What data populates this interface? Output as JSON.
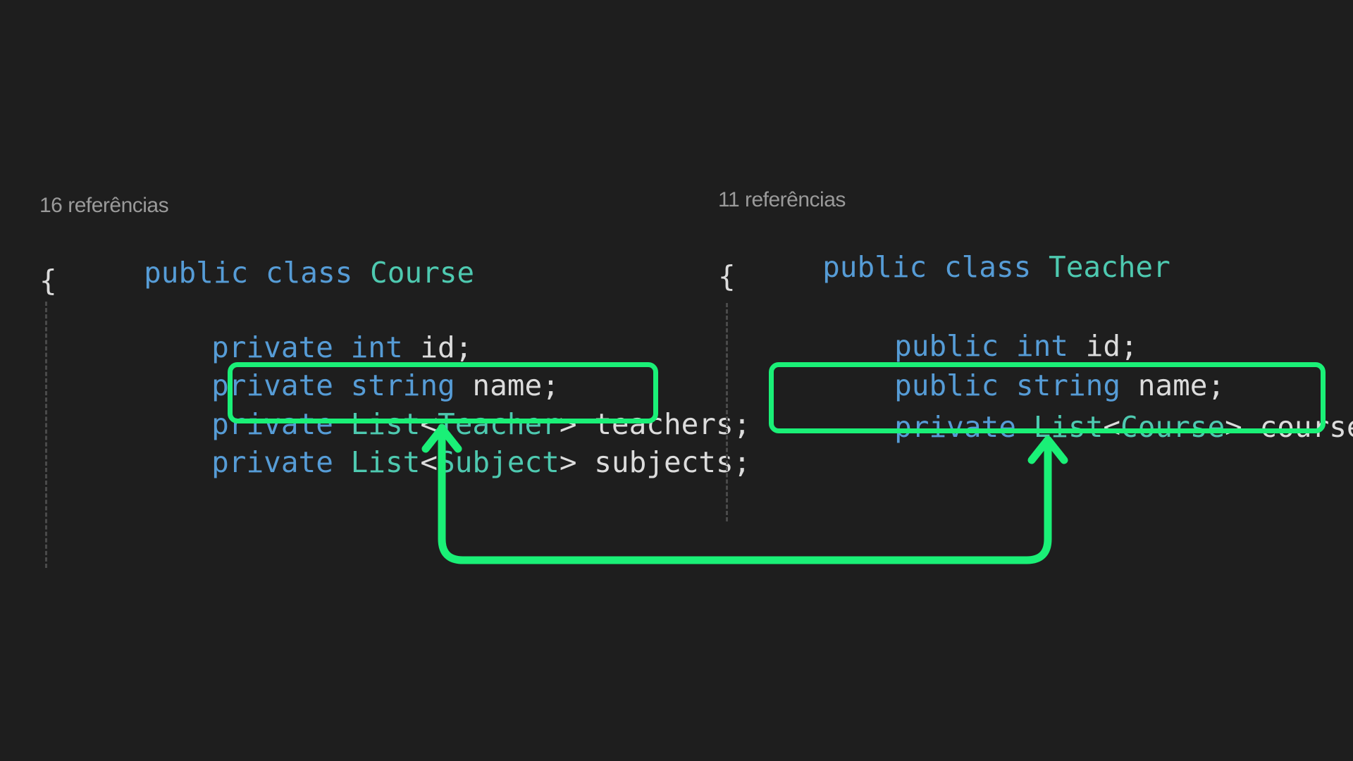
{
  "left_panel": {
    "codelens": "16 referências",
    "line1": {
      "kw1": "public",
      "kw2": "class",
      "type": "Course"
    },
    "open_brace": "{",
    "fields": [
      {
        "mod": "private",
        "type_kw": "int",
        "name": "id;"
      },
      {
        "mod": "private",
        "type_kw": "string",
        "name": "name;"
      },
      {
        "mod": "private",
        "generic": "List",
        "lt": "<",
        "arg": "Teacher",
        "gt": ">",
        "name": "teachers;"
      },
      {
        "mod": "private",
        "generic": "List",
        "lt": "<",
        "arg": "Subject",
        "gt": ">",
        "name": "subjects;"
      }
    ]
  },
  "right_panel": {
    "codelens": "11 referências",
    "line1": {
      "kw1": "public",
      "kw2": "class",
      "type": "Teacher"
    },
    "open_brace": "{",
    "fields": [
      {
        "mod": "public",
        "type_kw": "int",
        "name": "id;"
      },
      {
        "mod": "public",
        "type_kw": "string",
        "name": "name;"
      },
      {
        "mod": "private",
        "generic": "List",
        "lt": "<",
        "arg": "Course",
        "gt": ">",
        "name": "courses;"
      }
    ]
  },
  "colors": {
    "background": "#1e1e1e",
    "keyword": "#569cd6",
    "type": "#4ec9b0",
    "identifier": "#dcdcdc",
    "codelens": "#9a9a9a",
    "highlight": "#1af077"
  },
  "annotations": {
    "arrow": "bidirectional-arrow-icon"
  }
}
